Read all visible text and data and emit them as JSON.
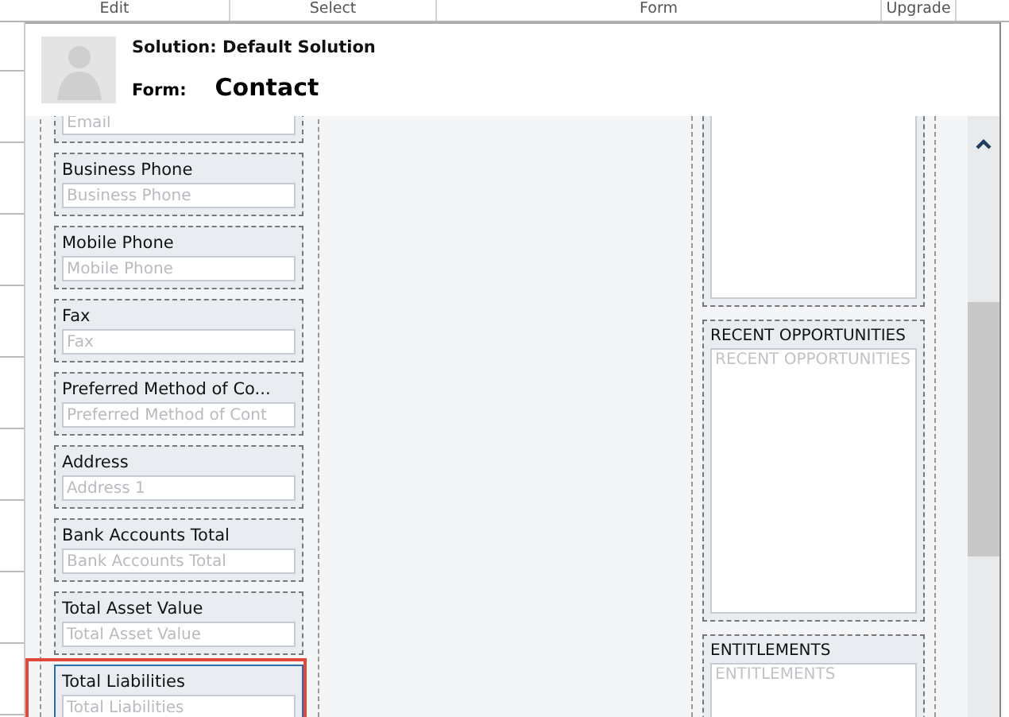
{
  "ribbon_groups": [
    "Edit",
    "Select",
    "Form",
    "Upgrade"
  ],
  "header": {
    "solution_label": "Solution: Default Solution",
    "form_label": "Form:",
    "form_name": "Contact"
  },
  "fields": [
    {
      "placeholder": "Email",
      "selected": false
    },
    {
      "label": "Business Phone",
      "placeholder": "Business Phone",
      "selected": false
    },
    {
      "label": "Mobile Phone",
      "placeholder": "Mobile Phone",
      "selected": false
    },
    {
      "label": "Fax",
      "placeholder": "Fax",
      "selected": false
    },
    {
      "label": "Preferred Method of Co...",
      "placeholder": "Preferred Method of Cont",
      "selected": false
    },
    {
      "label": "Address",
      "placeholder": "Address 1",
      "selected": false
    },
    {
      "label": "Bank Accounts Total",
      "placeholder": "Bank Accounts Total",
      "selected": false
    },
    {
      "label": "Total Asset Value",
      "placeholder": "Total Asset Value",
      "selected": false
    },
    {
      "label": "Total Liabilities",
      "placeholder": "Total Liabilities",
      "selected": true
    }
  ],
  "subgrids": [
    {
      "kind": "subgrid"
    },
    {
      "kind": "subgrid",
      "label": "RECENT OPPORTUNITIES",
      "placeholder": "RECENT OPPORTUNITIES"
    },
    {
      "kind": "subgrid",
      "label": "ENTITLEMENTS",
      "placeholder": "ENTITLEMENTS"
    }
  ]
}
